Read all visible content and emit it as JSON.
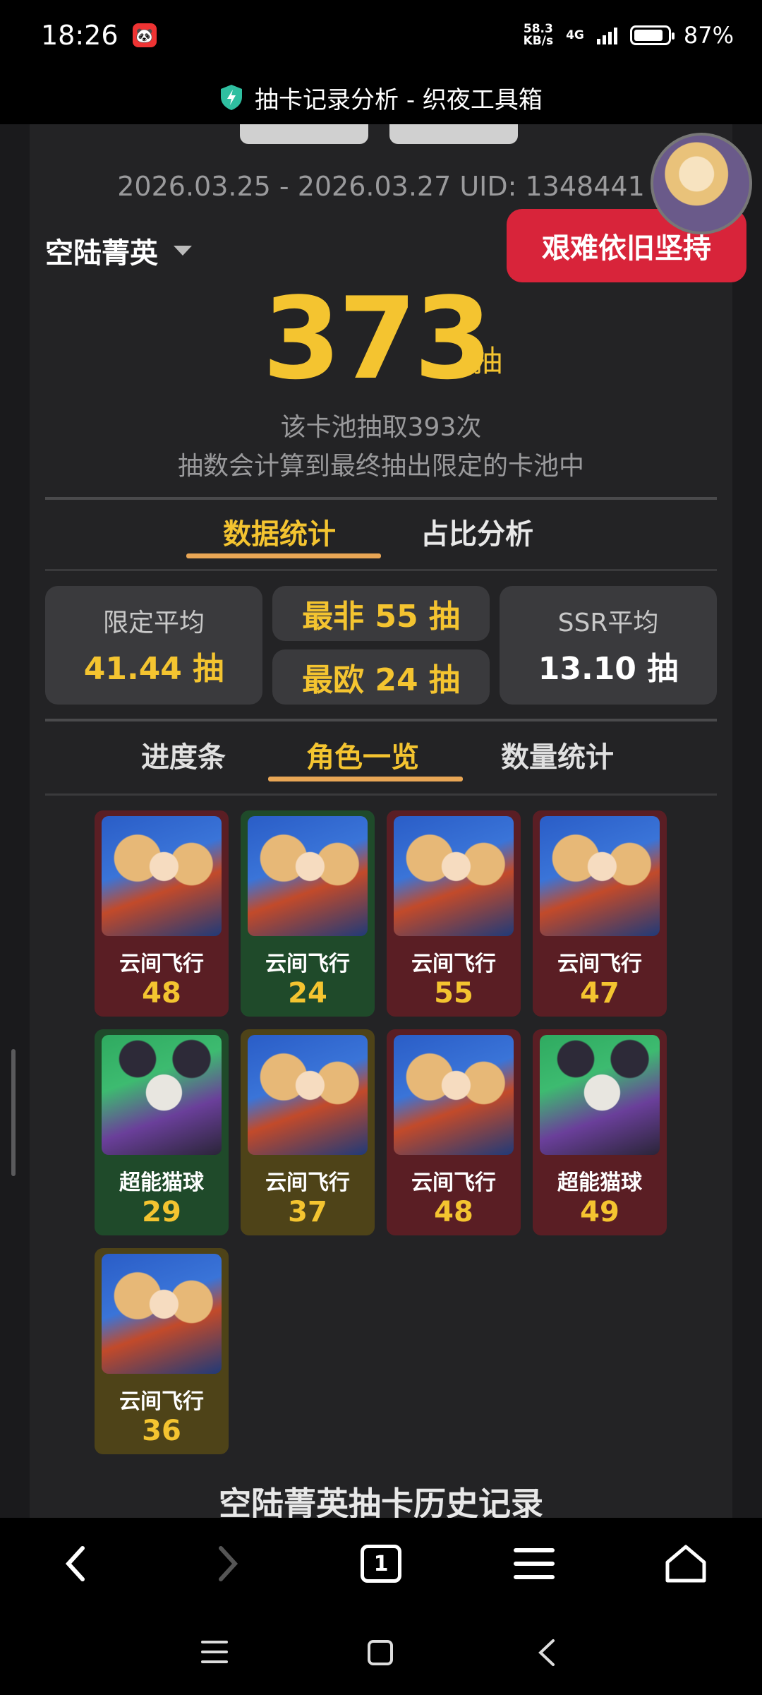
{
  "status_bar": {
    "time": "18:26",
    "net_speed_value": "58.3",
    "net_speed_unit": "KB/s",
    "network": "4G",
    "battery": "87%",
    "battery_fraction": 0.87
  },
  "title_bar": {
    "title": "抽卡记录分析 - 织夜工具箱"
  },
  "summary": {
    "date_range": "2026.03.25 - 2026.03.27 UID: 1348441",
    "pool_name": "空陆菁英",
    "badge": "艰难依旧坚持",
    "total_pulls": "373",
    "unit": "抽",
    "note_line1": "该卡池抽取393次",
    "note_line2": "抽数会计算到最终抽出限定的卡池中"
  },
  "stats_tabs": [
    {
      "label": "数据统计",
      "active": true
    },
    {
      "label": "占比分析",
      "active": false
    }
  ],
  "stats": {
    "limited_avg_label": "限定平均",
    "limited_avg_value": "41.44 抽",
    "worst": "最非 55 抽",
    "best": "最欧 24 抽",
    "ssr_avg_label": "SSR平均",
    "ssr_avg_value": "13.10 抽"
  },
  "view_tabs": [
    {
      "label": "进度条",
      "active": false
    },
    {
      "label": "角色一览",
      "active": true
    },
    {
      "label": "数量统计",
      "active": false
    }
  ],
  "cards": [
    {
      "name": "云间飞行",
      "count": "48",
      "color": "red",
      "art": "plane"
    },
    {
      "name": "云间飞行",
      "count": "24",
      "color": "green",
      "art": "plane"
    },
    {
      "name": "云间飞行",
      "count": "55",
      "color": "red",
      "art": "plane"
    },
    {
      "name": "云间飞行",
      "count": "47",
      "color": "red",
      "art": "plane"
    },
    {
      "name": "超能猫球",
      "count": "29",
      "color": "green",
      "art": "cat"
    },
    {
      "name": "云间飞行",
      "count": "37",
      "color": "olive",
      "art": "plane"
    },
    {
      "name": "云间飞行",
      "count": "48",
      "color": "red",
      "art": "plane"
    },
    {
      "name": "超能猫球",
      "count": "49",
      "color": "red",
      "art": "cat"
    },
    {
      "name": "云间飞行",
      "count": "36",
      "color": "olive",
      "art": "plane"
    }
  ],
  "history_title": "空陆菁英抽卡历史记录",
  "browser_nav": {
    "back_icon": "chevron-left-icon",
    "forward_icon": "chevron-right-icon",
    "tabs_count": "1",
    "menu_icon": "hamburger-icon",
    "home_icon": "home-icon"
  },
  "colors": {
    "accent_gold": "#f4c430",
    "tab_underline": "#e8a655",
    "badge_red": "#d8243a",
    "card_red": "#5a1e24",
    "card_green": "#1f4a2a",
    "card_olive": "#4e4318"
  }
}
